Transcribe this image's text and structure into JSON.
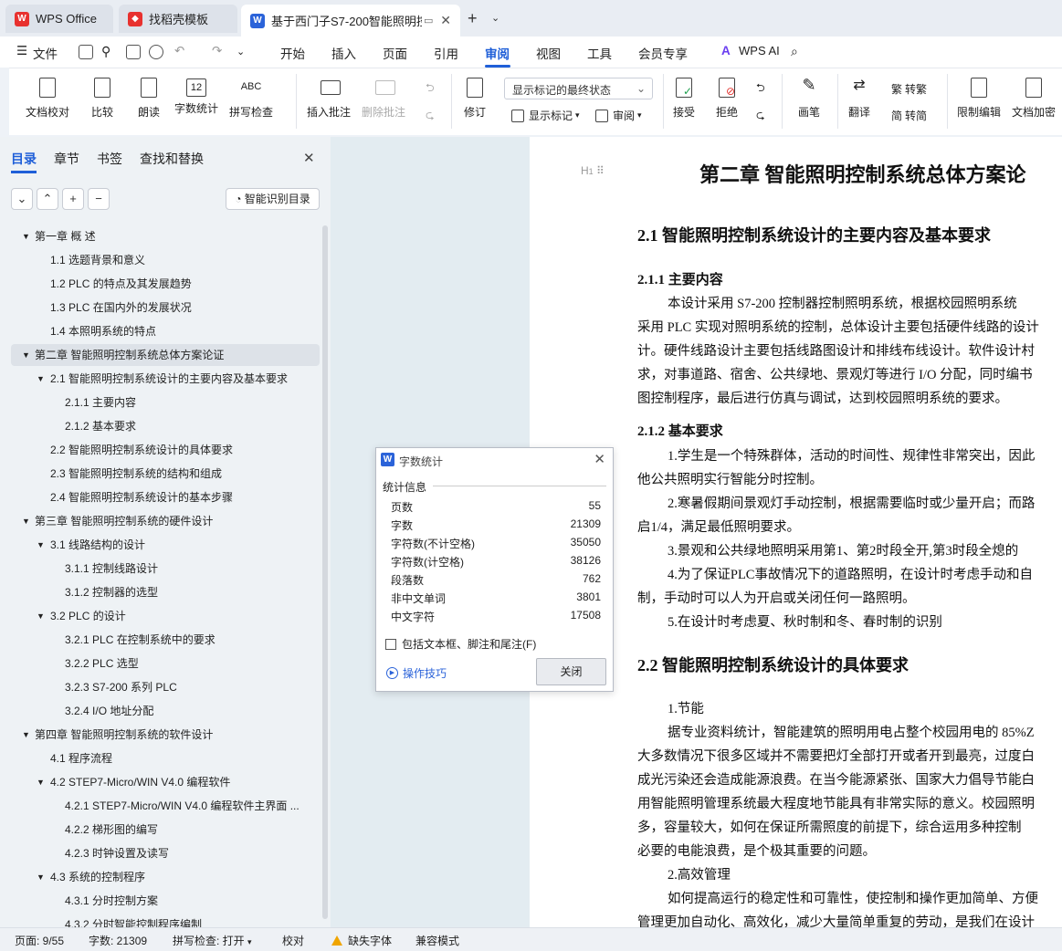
{
  "tabs": {
    "wps": "WPS Office",
    "daoke": "找稻壳模板",
    "doc": "基于西门子S7-200智能照明控"
  },
  "menu": {
    "file": "文件",
    "items": [
      "开始",
      "插入",
      "页面",
      "引用",
      "审阅",
      "视图",
      "工具",
      "会员专享"
    ],
    "active": "审阅",
    "wps_ai": "WPS AI"
  },
  "ribbon": {
    "doc_check": "文档校对",
    "compare": "比较",
    "read_aloud": "朗读",
    "word_count": "字数统计",
    "spell_check": "拼写检查",
    "insert_comment": "插入批注",
    "delete_comment": "删除批注",
    "track_status": "显示标记的最终状态",
    "revise": "修订",
    "show_markup": "显示标记",
    "review": "审阅",
    "accept": "接受",
    "reject": "拒绝",
    "pen": "画笔",
    "translate": "翻译",
    "to_traditional": "转繁",
    "to_simplified": "转简",
    "restrict_edit": "限制编辑",
    "doc_encrypt": "文档加密",
    "word_count_icon_text": "12",
    "spell_icon_text": "ABC"
  },
  "nav": {
    "tabs": [
      "目录",
      "章节",
      "书签",
      "查找和替换"
    ],
    "smart_toc": "智能识别目录",
    "toc": [
      {
        "text": "第一章  概    述",
        "level": 1,
        "arrow": true
      },
      {
        "text": "1.1  选题背景和意义",
        "level": 2
      },
      {
        "text": "1.2 PLC 的特点及其发展趋势",
        "level": 2
      },
      {
        "text": "1.3 PLC 在国内外的发展状况",
        "level": 2
      },
      {
        "text": "1.4  本照明系统的特点",
        "level": 2
      },
      {
        "text": "第二章  智能照明控制系统总体方案论证",
        "level": 1,
        "arrow": true,
        "selected": true
      },
      {
        "text": "2.1  智能照明控制系统设计的主要内容及基本要求",
        "level": 2,
        "arrow": true
      },
      {
        "text": "2.1.1  主要内容",
        "level": 3
      },
      {
        "text": "2.1.2  基本要求",
        "level": 3
      },
      {
        "text": "2.2  智能照明控制系统设计的具体要求",
        "level": 2
      },
      {
        "text": "2.3  智能照明控制系统的结构和组成",
        "level": 2
      },
      {
        "text": "2.4  智能照明控制系统设计的基本步骤",
        "level": 2
      },
      {
        "text": "第三章  智能照明控制系统的硬件设计",
        "level": 1,
        "arrow": true
      },
      {
        "text": "3.1  线路结构的设计",
        "level": 2,
        "arrow": true
      },
      {
        "text": "3.1.1  控制线路设计",
        "level": 3
      },
      {
        "text": "3.1.2  控制器的选型",
        "level": 3
      },
      {
        "text": "3.2 PLC 的设计",
        "level": 2,
        "arrow": true
      },
      {
        "text": "3.2.1 PLC 在控制系统中的要求",
        "level": 3
      },
      {
        "text": "3.2.2 PLC 选型",
        "level": 3
      },
      {
        "text": "3.2.3 S7-200 系列 PLC",
        "level": 3
      },
      {
        "text": "3.2.4 I/O 地址分配",
        "level": 3
      },
      {
        "text": "第四章  智能照明控制系统的软件设计",
        "level": 1,
        "arrow": true
      },
      {
        "text": "4.1  程序流程",
        "level": 2
      },
      {
        "text": "4.2 STEP7-Micro/WIN V4.0 编程软件",
        "level": 2,
        "arrow": true
      },
      {
        "text": "4.2.1 STEP7-Micro/WIN V4.0 编程软件主界面 ...",
        "level": 3
      },
      {
        "text": "4.2.2  梯形图的编写",
        "level": 3
      },
      {
        "text": "4.2.3  时钟设置及读写",
        "level": 3
      },
      {
        "text": "4.3  系统的控制程序",
        "level": 2,
        "arrow": true
      },
      {
        "text": "4.3.1  分时控制方案",
        "level": 3
      },
      {
        "text": "4.3.2  分时智能控制程序编制",
        "level": 3
      }
    ]
  },
  "doc": {
    "heading_mark": "H",
    "chapter_title": "第二章  智能照明控制系统总体方案论",
    "sec_2_1": "2.1  智能照明控制系统设计的主要内容及基本要求",
    "sec_2_1_1": "2.1.1  主要内容",
    "p1": [
      "本设计采用 S7-200 控制器控制照明系统，根据校园照明系统",
      "采用 PLC 实现对照明系统的控制，总体设计主要包括硬件线路的设计",
      "计。硬件线路设计主要包括线路图设计和排线布线设计。软件设计村",
      "求，对事道路、宿舍、公共绿地、景观灯等进行 I/O 分配，同时编书",
      "图控制程序，最后进行仿真与调试，达到校园照明系统的要求。"
    ],
    "sec_2_1_2": "2.1.2  基本要求",
    "p2": [
      "1.学生是一个特殊群体，活动的时间性、规律性非常突出，因此",
      "他公共照明实行智能分时控制。",
      "2.寒暑假期间景观灯手动控制，根据需要临时或少量开启；而路",
      "启1/4，满足最低照明要求。",
      "3.景观和公共绿地照明采用第1、第2时段全开,第3时段全熄的",
      "4.为了保证PLC事故情况下的道路照明，在设计时考虑手动和自",
      "制，手动时可以人为开启或关闭任何一路照明。",
      "5.在设计时考虑夏、秋时制和冬、春时制的识别"
    ],
    "sec_2_2": "2.2  智能照明控制系统设计的具体要求",
    "p3": [
      "1.节能",
      "据专业资料统计，智能建筑的照明用电占整个校园用电的 85%Z",
      "大多数情况下很多区域并不需要把灯全部打开或者开到最亮，过度白",
      "成光污染还会造成能源浪费。在当今能源紧张、国家大力倡导节能白",
      "用智能照明管理系统最大程度地节能具有非常实际的意义。校园照明",
      "多，容量较大，如何在保证所需照度的前提下，综合运用多种控制",
      "必要的电能浪费，是个极其重要的问题。",
      "2.高效管理",
      "如何提高运行的稳定性和可靠性，使控制和操作更加简单、方便",
      "管理更加自动化、高效化，减少大量简单重复的劳动，是我们在设计"
    ]
  },
  "dialog": {
    "title": "字数统计",
    "section": "统计信息",
    "stats": [
      {
        "label": "页数",
        "value": "55"
      },
      {
        "label": "字数",
        "value": "21309"
      },
      {
        "label": "字符数(不计空格)",
        "value": "35050"
      },
      {
        "label": "字符数(计空格)",
        "value": "38126"
      },
      {
        "label": "段落数",
        "value": "762"
      },
      {
        "label": "非中文单词",
        "value": "3801"
      },
      {
        "label": "中文字符",
        "value": "17508"
      }
    ],
    "include_label": "包括文本框、脚注和尾注(F)",
    "tips": "操作技巧",
    "close": "关闭"
  },
  "status": {
    "page": "页面: 9/55",
    "words": "字数: 21309",
    "spell": "拼写检查: 打开",
    "proof": "校对",
    "missing_font": "缺失字体",
    "compat": "兼容模式"
  },
  "colors": {
    "accent": "#1f5fd8",
    "wps_red": "#e8312f",
    "doc_blue": "#2b63d9"
  }
}
